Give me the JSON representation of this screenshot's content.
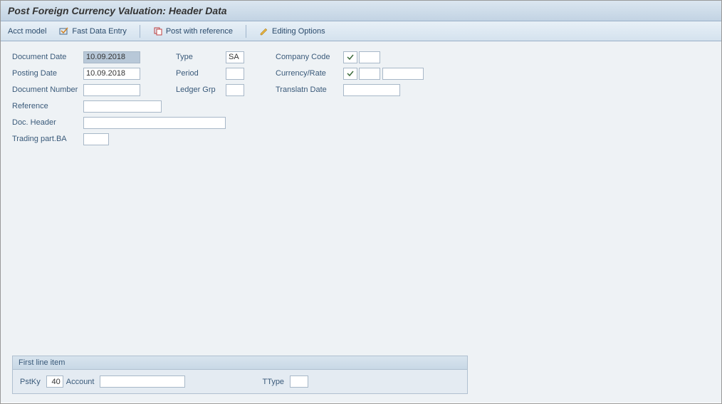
{
  "title": "Post Foreign Currency Valuation: Header Data",
  "toolbar": {
    "acctModel": "Acct model",
    "fastDataEntry": "Fast Data Entry",
    "postWithRef": "Post with reference",
    "editingOptions": "Editing Options"
  },
  "form": {
    "documentDateLabel": "Document Date",
    "documentDateValue": "10.09.2018",
    "typeLabel": "Type",
    "typeValue": "SA",
    "companyCodeLabel": "Company Code",
    "companyCodeValue": "",
    "postingDateLabel": "Posting Date",
    "postingDateValue": "10.09.2018",
    "periodLabel": "Period",
    "periodValue": "",
    "currencyRateLabel": "Currency/Rate",
    "currencyRateValue": "",
    "currencyRate2Value": "",
    "documentNumberLabel": "Document Number",
    "documentNumberValue": "",
    "ledgerGrpLabel": "Ledger Grp",
    "ledgerGrpValue": "",
    "translatnDateLabel": "Translatn Date",
    "translatnDateValue": "",
    "referenceLabel": "Reference",
    "referenceValue": "",
    "docHeaderLabel": "Doc. Header",
    "docHeaderValue": "",
    "tradingPartBALabel": "Trading part.BA",
    "tradingPartBAValue": ""
  },
  "panel": {
    "title": "First line item",
    "pstKyLabel": "PstKy",
    "pstKyValue": "40",
    "accountLabel": "Account",
    "accountValue": "",
    "ttypeLabel": "TType",
    "ttypeValue": ""
  }
}
